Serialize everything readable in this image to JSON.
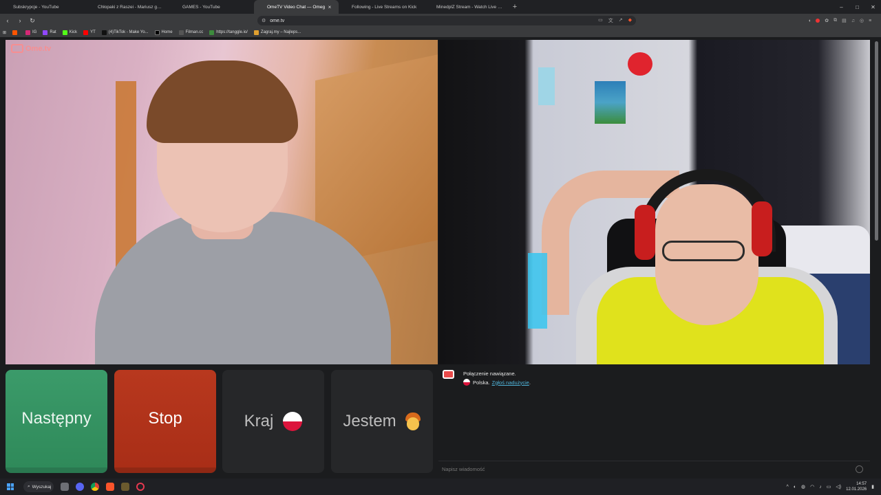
{
  "browser": {
    "tabs": [
      {
        "label": "Subskrypcje - YouTube",
        "color": "#ff0000",
        "active": false
      },
      {
        "label": "Chłopaki z Raszei - Mariusz gardzi p",
        "color": "#ff0000",
        "active": false
      },
      {
        "label": "GAMES - YouTube",
        "color": "#ff0000",
        "active": false
      },
      {
        "label": "OmeTV Video Chat — Omeg",
        "color": "#ff6d6d",
        "active": true
      },
      {
        "label": "Following - Live Streams on Kick",
        "color": "#53fc18",
        "active": false
      },
      {
        "label": "MinedplZ Stream - Watch Live on",
        "color": "#53fc18",
        "active": false
      }
    ],
    "tab_close": "×",
    "tab_new": "+",
    "window_controls": [
      "–",
      "□",
      "✕"
    ],
    "url": "ome.tv",
    "bookmarks": [
      {
        "label": "",
        "color": "#ff5500"
      },
      {
        "label": "IG",
        "color": "#d62976"
      },
      {
        "label": "Rat",
        "color": "#9147ff"
      },
      {
        "label": "Kick",
        "color": "#53fc18"
      },
      {
        "label": "YT",
        "color": "#ff0000"
      },
      {
        "label": "(4)TikTok - Make Yo...",
        "color": "#111111"
      },
      {
        "label": "Home",
        "color": "#000000"
      },
      {
        "label": "Filman.cc",
        "color": "#555555"
      },
      {
        "label": "https://tanggle.io/",
        "color": "#3d8b3d"
      },
      {
        "label": "Zagraj.my – Najleps...",
        "color": "#e0a030"
      }
    ]
  },
  "ome": {
    "logo_text": "Ome.tv",
    "buttons": {
      "next": "Następny",
      "stop": "Stop",
      "country": "Kraj",
      "gender": "Jestem"
    },
    "chat": {
      "connected": "Połączenie nawiązane.",
      "country": "Polska.",
      "report_link": "Zgłoś nadużycie",
      "report_suffix": ".",
      "input_placeholder": "Napisz wiadomość"
    }
  },
  "taskbar": {
    "search_label": "Wyszukaj",
    "time": "14:57",
    "date": "12.01.2026"
  },
  "colors": {
    "next_button": "#2f8a5a",
    "stop_button": "#a92e17",
    "ome_accent": "#ff6d6d",
    "link": "#4fb3d9"
  }
}
